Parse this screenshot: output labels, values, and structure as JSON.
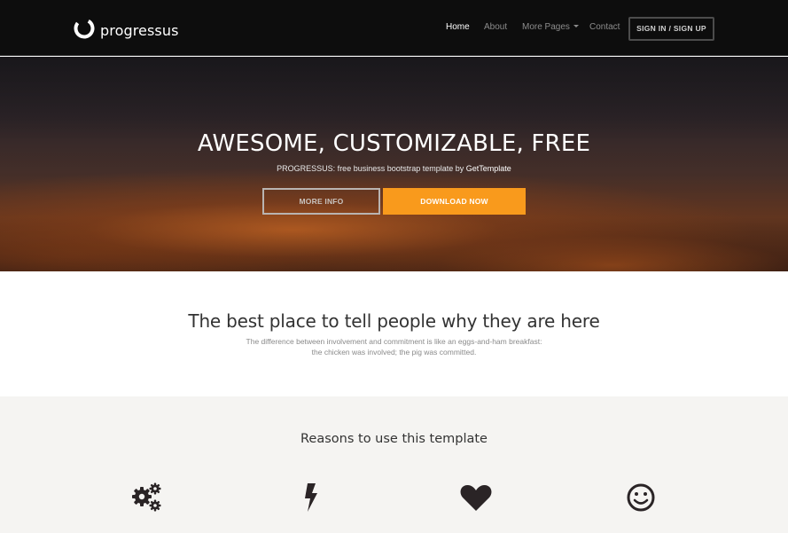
{
  "brand": {
    "name": "progressus"
  },
  "nav": {
    "items": [
      {
        "label": "Home",
        "active": true
      },
      {
        "label": "About",
        "active": false
      },
      {
        "label": "More Pages",
        "active": false,
        "dropdown": true
      },
      {
        "label": "Contact",
        "active": false
      }
    ],
    "signin_label": "SIGN IN / SIGN UP"
  },
  "hero": {
    "title": "AWESOME, CUSTOMIZABLE, FREE",
    "subtitle_prefix": "PROGRESSUS: free business bootstrap template by ",
    "subtitle_link": "GetTemplate",
    "more_info_label": "MORE INFO",
    "download_label": "DOWNLOAD NOW"
  },
  "intro": {
    "title": "The best place to tell people why they are here",
    "line1": "The difference between involvement and commitment is like an eggs-and-ham breakfast:",
    "line2": "the chicken was involved; the pig was committed."
  },
  "reasons": {
    "title": "Reasons to use this template",
    "icons": [
      "gears-icon",
      "flash-icon",
      "heart-icon",
      "smile-icon"
    ]
  },
  "colors": {
    "navbar_bg": "#0d0d0d",
    "accent_orange": "#f99a1c",
    "reasons_bg": "#f5f4f2",
    "icon_color": "#2a2426"
  }
}
